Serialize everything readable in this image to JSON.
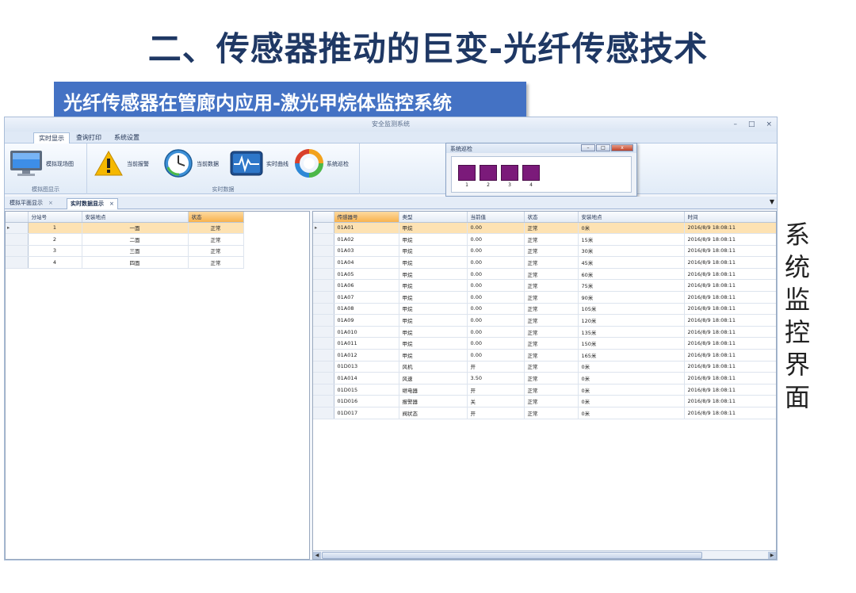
{
  "slide": {
    "title": "二、传感器推动的巨变-光纤传感技术",
    "subtitle": "光纤传感器在管廊内应用-激光甲烷体监控系统",
    "side_caption": [
      "系",
      "统",
      "监",
      "控",
      "界",
      "面"
    ]
  },
  "app": {
    "window_title": "安全监测系统",
    "window_controls": [
      "–",
      "□",
      "×"
    ],
    "menu_tabs": [
      "实时显示",
      "查询打印",
      "系统设置"
    ],
    "ribbon_groups": [
      {
        "label": "模拟图显示",
        "buttons": [
          {
            "label": "模拟现场图",
            "icon": "monitor-icon"
          }
        ]
      },
      {
        "label": "实时数据",
        "buttons": [
          {
            "label": "当前报警",
            "icon": "warning-icon"
          },
          {
            "label": "当前数据",
            "icon": "clock-icon"
          },
          {
            "label": "实时曲线",
            "icon": "waveform-icon"
          },
          {
            "label": "系统巡检",
            "icon": "refresh-cycle-icon"
          }
        ]
      }
    ],
    "popup": {
      "title": "系统巡检",
      "sensors": [
        "1",
        "2",
        "3",
        "4"
      ],
      "sensor_color": "#7b1a7a"
    },
    "doc_tabs": [
      {
        "label": "模拟平面显示",
        "active": false
      },
      {
        "label": "实时数据显示",
        "active": true
      }
    ],
    "left_table": {
      "columns": [
        "分站号",
        "安装地点",
        "状态"
      ],
      "rows": [
        [
          "1",
          "一面",
          "正常"
        ],
        [
          "2",
          "二面",
          "正常"
        ],
        [
          "3",
          "三面",
          "正常"
        ],
        [
          "4",
          "四面",
          "正常"
        ]
      ]
    },
    "right_table": {
      "columns": [
        "传感器号",
        "类型",
        "当前值",
        "状态",
        "安装地点",
        "时间"
      ],
      "rows": [
        [
          "01A01",
          "甲烷",
          "0.00",
          "正常",
          "0米",
          "2016/8/9 18:08:11"
        ],
        [
          "01A02",
          "甲烷",
          "0.00",
          "正常",
          "15米",
          "2016/8/9 18:08:11"
        ],
        [
          "01A03",
          "甲烷",
          "0.00",
          "正常",
          "30米",
          "2016/8/9 18:08:11"
        ],
        [
          "01A04",
          "甲烷",
          "0.00",
          "正常",
          "45米",
          "2016/8/9 18:08:11"
        ],
        [
          "01A05",
          "甲烷",
          "0.00",
          "正常",
          "60米",
          "2016/8/9 18:08:11"
        ],
        [
          "01A06",
          "甲烷",
          "0.00",
          "正常",
          "75米",
          "2016/8/9 18:08:11"
        ],
        [
          "01A07",
          "甲烷",
          "0.00",
          "正常",
          "90米",
          "2016/8/9 18:08:11"
        ],
        [
          "01A08",
          "甲烷",
          "0.00",
          "正常",
          "105米",
          "2016/8/9 18:08:11"
        ],
        [
          "01A09",
          "甲烷",
          "0.00",
          "正常",
          "120米",
          "2016/8/9 18:08:11"
        ],
        [
          "01A010",
          "甲烷",
          "0.00",
          "正常",
          "135米",
          "2016/8/9 18:08:11"
        ],
        [
          "01A011",
          "甲烷",
          "0.00",
          "正常",
          "150米",
          "2016/8/9 18:08:11"
        ],
        [
          "01A012",
          "甲烷",
          "0.00",
          "正常",
          "165米",
          "2016/8/9 18:08:11"
        ],
        [
          "01D013",
          "风机",
          "开",
          "正常",
          "0米",
          "2016/8/9 18:08:11"
        ],
        [
          "01A014",
          "风速",
          "3.50",
          "正常",
          "0米",
          "2016/8/9 18:08:11"
        ],
        [
          "01D015",
          "继电器",
          "开",
          "正常",
          "0米",
          "2016/8/9 18:08:11"
        ],
        [
          "01D016",
          "报警器",
          "关",
          "正常",
          "0米",
          "2016/8/9 18:08:11"
        ],
        [
          "01D017",
          "阀状态",
          "开",
          "正常",
          "0米",
          "2016/8/9 18:08:11"
        ]
      ]
    }
  }
}
